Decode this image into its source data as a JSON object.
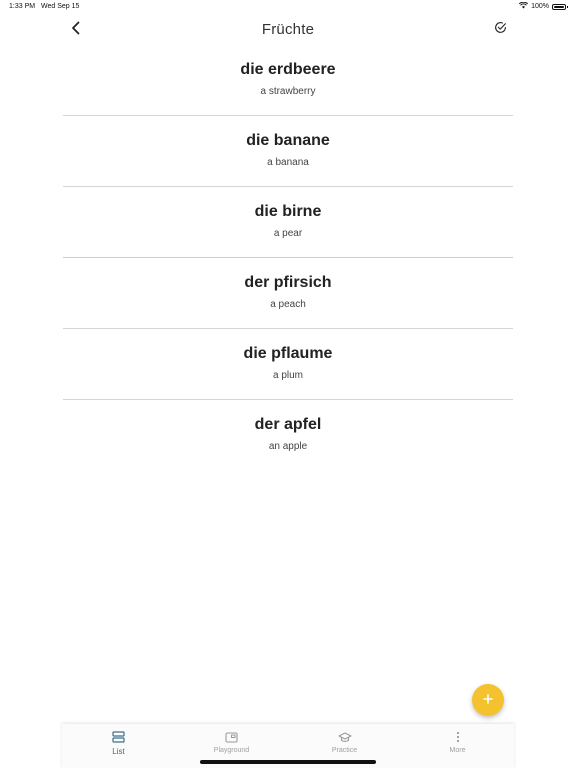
{
  "status_bar": {
    "time": "1:33 PM",
    "date": "Wed Sep 15",
    "battery": "100%"
  },
  "header": {
    "title": "Früchte",
    "back_icon": "chevron-left-icon",
    "action_icon": "check-circle-icon"
  },
  "vocabulary": [
    {
      "term": "die erdbeere",
      "translation": "a strawberry"
    },
    {
      "term": "die banane",
      "translation": "a banana"
    },
    {
      "term": "die birne",
      "translation": "a pear"
    },
    {
      "term": "der pfirsich",
      "translation": "a peach"
    },
    {
      "term": "die pflaume",
      "translation": "a plum"
    },
    {
      "term": "der apfel",
      "translation": "an apple"
    }
  ],
  "fab": {
    "icon": "plus-icon",
    "color": "#f5c22f"
  },
  "tabs": [
    {
      "label": "List",
      "icon": "list-icon",
      "active": true
    },
    {
      "label": "Playground",
      "icon": "playground-icon",
      "active": false
    },
    {
      "label": "Practice",
      "icon": "graduation-cap-icon",
      "active": false
    },
    {
      "label": "More",
      "icon": "more-vertical-icon",
      "active": false
    }
  ],
  "colors": {
    "accent": "#3a6f8a",
    "fab": "#f5c22f",
    "divider": "#d5d5d5",
    "inactive_tab": "#a0a0a0"
  }
}
